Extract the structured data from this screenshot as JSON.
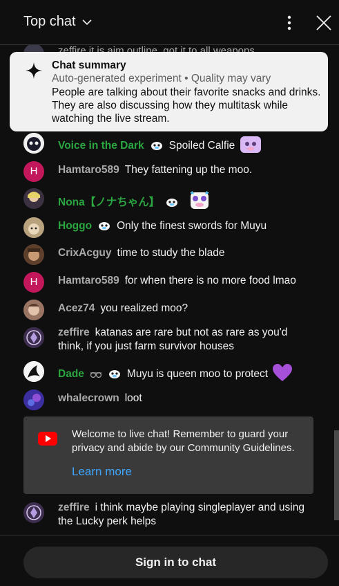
{
  "header": {
    "title": "Top chat"
  },
  "ghost_message": {
    "text": "zeffire  it is aim outline, got it to all weapons"
  },
  "summary": {
    "title": "Chat summary",
    "subtitle": "Auto-generated experiment • Quality may vary",
    "body": "People are talking about their favorite snacks and drinks. They are also discussing how they multitask while watching the live stream."
  },
  "messages": [
    {
      "author": "Voice in the Dark",
      "text": "Spoiled Calfie",
      "member": true
    },
    {
      "author": "Hamtaro589",
      "text": "They fattening up the moo.",
      "member": false,
      "avatar_letter": "H"
    },
    {
      "author": "Nona【ノナちゃん】",
      "text": "",
      "member": true
    },
    {
      "author": "Hoggo",
      "text": "Only the finest swords for Muyu",
      "member": true
    },
    {
      "author": "CrixAcguy",
      "text": "time to study the blade",
      "member": false
    },
    {
      "author": "Hamtaro589",
      "text": "for when there is no more food lmao",
      "member": false,
      "avatar_letter": "H"
    },
    {
      "author": "Acez74",
      "text": "you realized moo?",
      "member": false
    },
    {
      "author": "zeffire",
      "text": "katanas are rare but not as rare as you'd think, if you just farm survivor houses",
      "member": false
    },
    {
      "author": "Dade",
      "text": "Muyu is queen moo to protect",
      "member": true
    },
    {
      "author": "whalecrown",
      "text": "loot",
      "member": false
    },
    {
      "author": "zeffire",
      "text": "i think maybe playing singleplayer and using the Lucky perk helps",
      "member": false
    }
  ],
  "welcome": {
    "text": "Welcome to live chat! Remember to guard your privacy and abide by our Community Guidelines.",
    "link": "Learn more"
  },
  "footer": {
    "signin_label": "Sign in to chat"
  },
  "colors": {
    "member_green": "#2ba640",
    "link_blue": "#3ea6ff",
    "avatar_pink": "#c2185b"
  }
}
